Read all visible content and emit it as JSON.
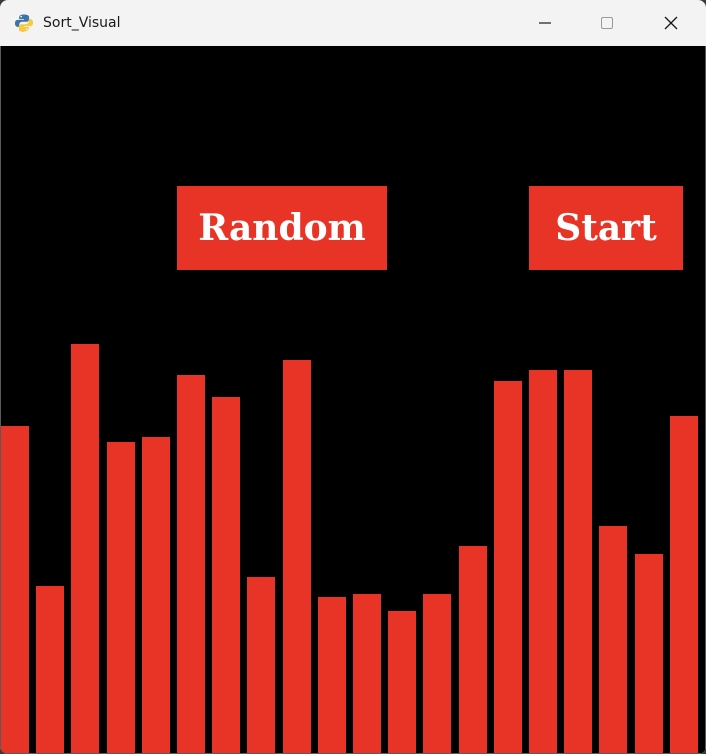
{
  "window": {
    "title": "Sort_Visual"
  },
  "buttons": {
    "random_label": "Random",
    "start_label": "Start"
  },
  "colors": {
    "canvas_bg": "#000000",
    "accent_red": "#e83426",
    "button_text": "#ffffff"
  },
  "icons": {
    "app": "python-icon",
    "minimize": "minimize-icon",
    "maximize": "maximize-icon",
    "close": "close-icon"
  },
  "bars": {
    "count": 20,
    "values": [
      327,
      167,
      409,
      311,
      316,
      378,
      356,
      176,
      393,
      156,
      159,
      142,
      159,
      207,
      372,
      383,
      383,
      227,
      199,
      337
    ]
  }
}
